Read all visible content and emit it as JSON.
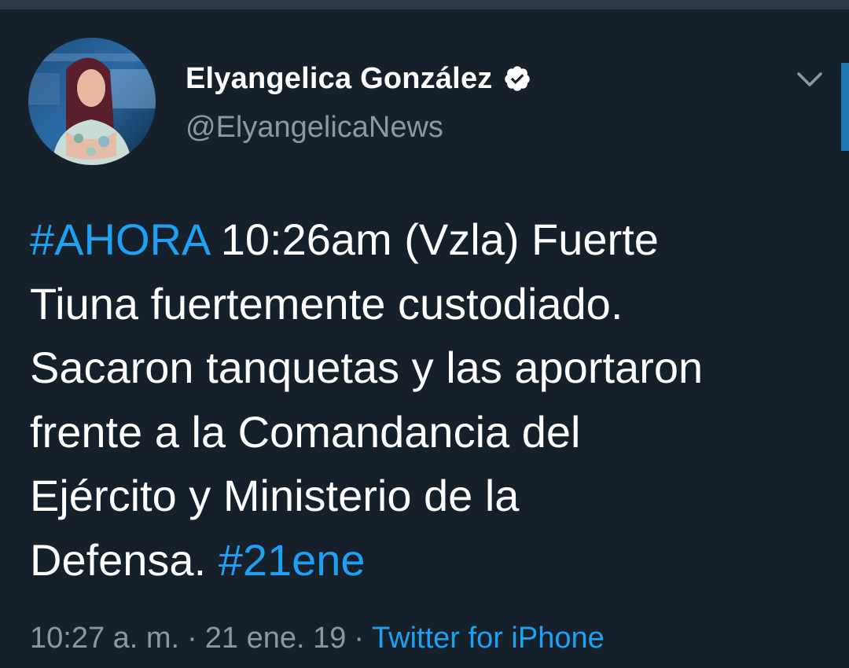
{
  "tweet": {
    "author": {
      "display_name": "Elyangelica González",
      "handle": "@ElyangelicaNews",
      "verified": true
    },
    "text_lines": [
      [
        {
          "text": "#AHORA",
          "hashtag": true
        },
        {
          "text": " 10:26am (Vzla) Fuerte",
          "hashtag": false
        }
      ],
      [
        {
          "text": "Tiuna fuertemente custodiado.",
          "hashtag": false
        }
      ],
      [
        {
          "text": "Sacaron tanquetas y las aportaron",
          "hashtag": false
        }
      ],
      [
        {
          "text": "frente a la Comandancia del",
          "hashtag": false
        }
      ],
      [
        {
          "text": "Ejército y Ministerio de la",
          "hashtag": false
        }
      ],
      [
        {
          "text": "Defensa. ",
          "hashtag": false
        },
        {
          "text": "#21ene",
          "hashtag": true
        }
      ]
    ],
    "meta": {
      "time": "10:27 a. m.",
      "separator": "·",
      "date": "21 ene. 19",
      "source": "Twitter for iPhone"
    }
  },
  "icons": {
    "verified": "verified-badge-icon",
    "menu": "chevron-down-icon"
  },
  "colors": {
    "background": "#15202b",
    "hashtag": "#1da1f2",
    "secondary_text": "#8899a6",
    "primary_text": "#ffffff"
  }
}
